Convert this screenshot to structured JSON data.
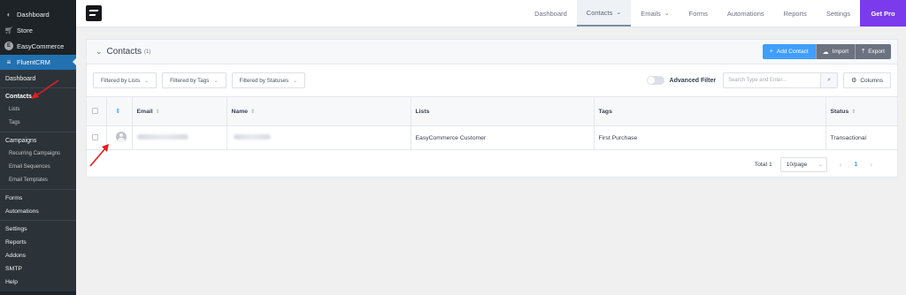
{
  "sidebar": {
    "top_items": [
      {
        "label": "Dashboard",
        "icon": "dashboard-icon"
      },
      {
        "label": "Store",
        "icon": "cart-icon"
      },
      {
        "label": "EasyCommerce",
        "icon": "easycommerce-icon"
      }
    ],
    "active": {
      "label": "FluentCRM",
      "icon": "fluentcrm-icon"
    },
    "sub": {
      "dashboard": "Dashboard",
      "contacts": "Contacts",
      "lists": "Lists",
      "tags": "Tags",
      "campaigns": "Campaigns",
      "recurring": "Recurring Campaigns",
      "sequences": "Email Sequences",
      "templates": "Email Templates",
      "forms": "Forms",
      "automations": "Automations",
      "settings": "Settings",
      "reports": "Reports",
      "addons": "Addons",
      "smtp": "SMTP",
      "help": "Help"
    }
  },
  "topnav": {
    "dashboard": "Dashboard",
    "contacts": "Contacts",
    "emails": "Emails",
    "forms": "Forms",
    "automations": "Automations",
    "reports": "Reports",
    "settings": "Settings",
    "get_pro": "Get Pro"
  },
  "card": {
    "title": "Contacts",
    "count": "(1)",
    "add_contact": "Add Contact",
    "import": "Import",
    "export": "Export"
  },
  "filters": {
    "lists": "Filtered by Lists",
    "tags": "Filtered by Tags",
    "statuses": "Filtered by Statuses",
    "advanced": "Advanced Filter",
    "search_placeholder": "Search Type and Enter...",
    "columns": "Columns"
  },
  "table": {
    "headers": {
      "email": "Email",
      "name": "Name",
      "lists": "Lists",
      "tags": "Tags",
      "status": "Status"
    },
    "rows": [
      {
        "lists": "EasyCommerce Customer",
        "tags": "First Purchase",
        "status": "Transactional"
      }
    ]
  },
  "pager": {
    "total": "Total 1",
    "page_size": "10/page",
    "current": "1"
  },
  "colors": {
    "wp_sidebar": "#1d2327",
    "wp_active": "#2271b1",
    "primary": "#409eff",
    "get_pro": "#7c3aed",
    "annotation_arrow": "#e01e1e"
  }
}
